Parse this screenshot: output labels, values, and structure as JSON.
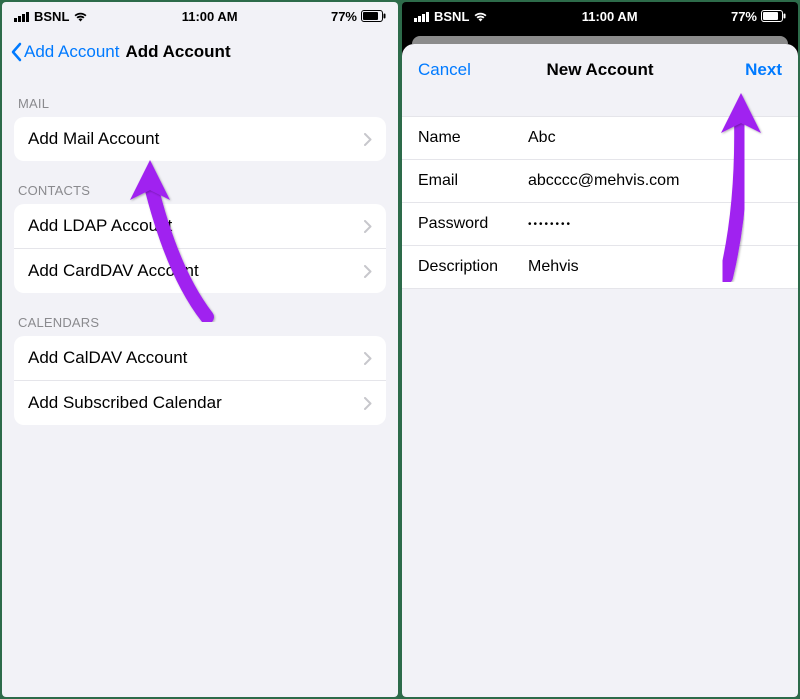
{
  "status": {
    "carrier": "BSNL",
    "time": "11:00 AM",
    "battery": "77%"
  },
  "left": {
    "nav_back": "Add Account",
    "nav_title": "Add Account",
    "sections": {
      "mail_header": "MAIL",
      "mail_item": "Add Mail Account",
      "contacts_header": "CONTACTS",
      "ldap_item": "Add LDAP Account",
      "carddav_item": "Add CardDAV Account",
      "calendars_header": "CALENDARS",
      "caldav_item": "Add CalDAV Account",
      "subscribed_item": "Add Subscribed Calendar"
    }
  },
  "right": {
    "cancel": "Cancel",
    "title": "New Account",
    "next": "Next",
    "form": {
      "name_label": "Name",
      "name_value": "Abc",
      "email_label": "Email",
      "email_value": "abcccc@mehvis.com",
      "password_label": "Password",
      "password_value": "••••••••",
      "description_label": "Description",
      "description_value": "Mehvis"
    }
  }
}
